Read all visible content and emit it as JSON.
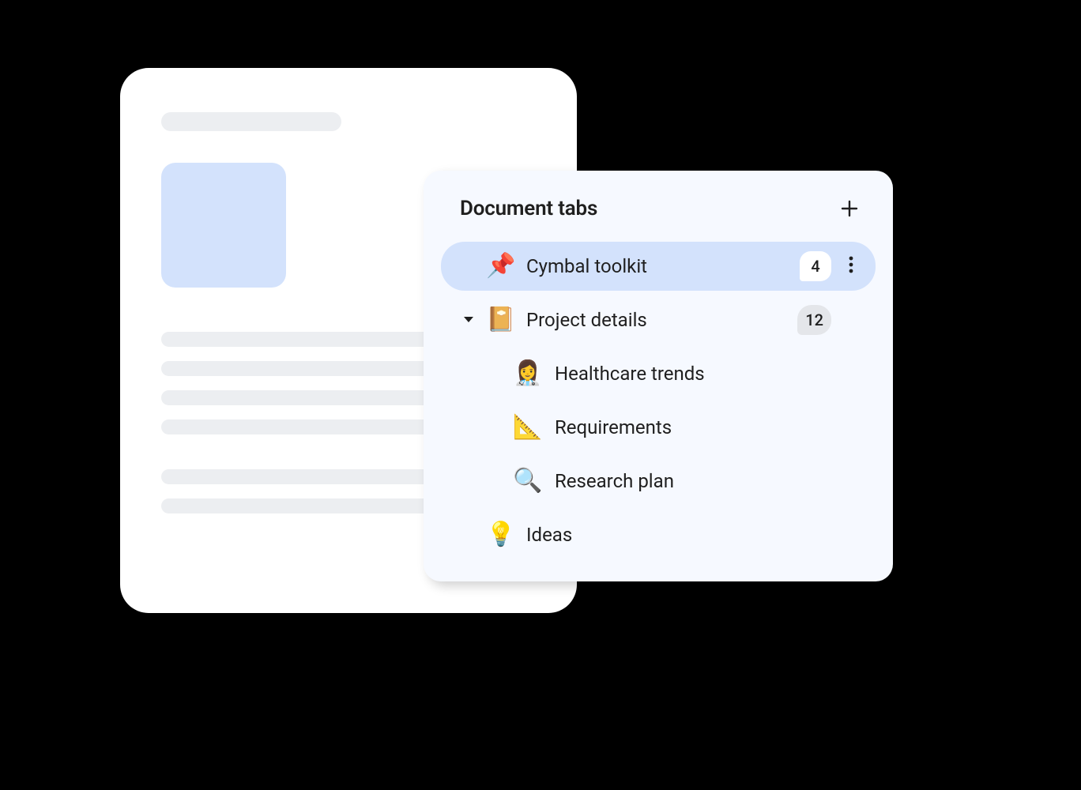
{
  "panel": {
    "title": "Document tabs"
  },
  "tabs": [
    {
      "emoji": "📌",
      "label": "Cymbal toolkit",
      "badge": "4",
      "badgeStyle": "white",
      "active": true,
      "expandable": false,
      "showMore": true,
      "indent": 1
    },
    {
      "emoji": "📔",
      "label": "Project details",
      "badge": "12",
      "badgeStyle": "grey",
      "active": false,
      "expandable": true,
      "expanded": true,
      "indent": 1
    },
    {
      "emoji": "👩‍⚕️",
      "label": "Healthcare trends",
      "indent": 2
    },
    {
      "emoji": "📐",
      "label": "Requirements",
      "indent": 2
    },
    {
      "emoji": "🔍",
      "label": "Research plan",
      "indent": 2
    },
    {
      "emoji": "💡",
      "label": "Ideas",
      "indent": 1
    }
  ]
}
